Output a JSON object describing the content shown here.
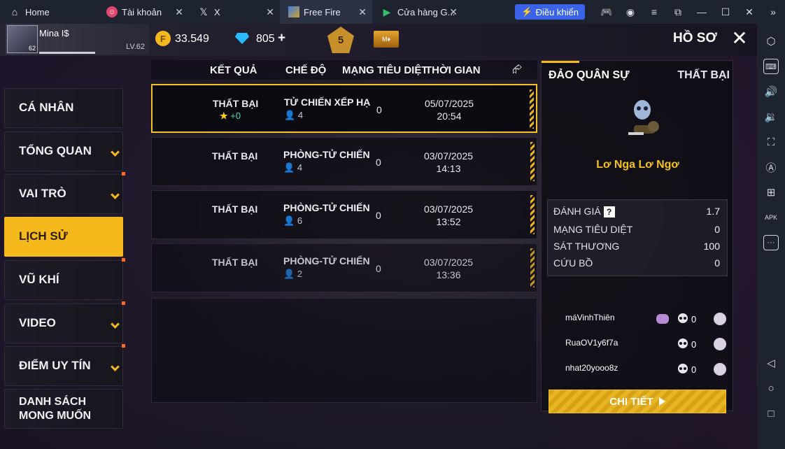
{
  "browser": {
    "tabs": [
      {
        "title": "Home",
        "icon": "home-icon",
        "closable": false
      },
      {
        "title": "Tài khoản",
        "icon": "account-app-icon",
        "closable": true
      },
      {
        "title": "X",
        "icon": "x-logo-icon",
        "closable": true
      },
      {
        "title": "Free Fire",
        "icon": "free-fire-app-icon",
        "closable": true
      },
      {
        "title": "Cửa hàng G...",
        "icon": "play-store-icon",
        "closable": true
      }
    ],
    "control_button": "Điều khiển"
  },
  "player": {
    "name": "Mina I$",
    "level_label": "LV.62",
    "avatar_level": "62"
  },
  "currency": {
    "gold": "33.549",
    "diamonds": "805"
  },
  "rank_badge": "5",
  "page_title": "HỒ SƠ",
  "menu": [
    {
      "label": "CÁ NHÂN",
      "chevron": false,
      "dot": false,
      "active": false
    },
    {
      "label": "TỔNG QUAN",
      "chevron": true,
      "dot": false,
      "active": false
    },
    {
      "label": "VAI TRÒ",
      "chevron": true,
      "dot": true,
      "active": false
    },
    {
      "label": "LỊCH SỬ",
      "chevron": false,
      "dot": false,
      "active": true
    },
    {
      "label": "VŨ KHÍ",
      "chevron": false,
      "dot": true,
      "active": false
    },
    {
      "label": "VIDEO",
      "chevron": true,
      "dot": true,
      "active": false
    },
    {
      "label": "ĐIỂM UY TÍN",
      "chevron": true,
      "dot": true,
      "active": false
    },
    {
      "label": "DANH SÁCH MONG MUỐN",
      "chevron": false,
      "dot": false,
      "active": false
    }
  ],
  "table": {
    "headers": {
      "result": "KẾT QUẢ",
      "mode": "CHẾ ĐỘ",
      "kills": "MẠNG TIÊU DIỆT",
      "time": "THỜI GIAN"
    },
    "rows": [
      {
        "result": "THẤT BẠI",
        "gain": "+0",
        "mode": "TỬ CHIẾN XẾP HẠ",
        "players": "4",
        "kills": "0",
        "date": "05/07/2025",
        "time": "20:54"
      },
      {
        "result": "THẤT BẠI",
        "gain": "",
        "mode": "PHÒNG-TỬ CHIẾN",
        "players": "4",
        "kills": "0",
        "date": "03/07/2025",
        "time": "14:13"
      },
      {
        "result": "THẤT BẠI",
        "gain": "",
        "mode": "PHÒNG-TỬ CHIẾN",
        "players": "6",
        "kills": "0",
        "date": "03/07/2025",
        "time": "13:52"
      },
      {
        "result": "THẤT BẠI",
        "gain": "",
        "mode": "PHÒNG-TỬ CHIẾN",
        "players": "2",
        "kills": "0",
        "date": "03/07/2025",
        "time": "13:36"
      }
    ]
  },
  "detail": {
    "map": "ĐẢO QUÂN SỰ",
    "result": "THẤT BẠI",
    "character": "Lơ Nga Lơ Ngơ",
    "stats": [
      {
        "label": "ĐÁNH GIÁ",
        "value": "1.7",
        "help": true
      },
      {
        "label": "MẠNG TIÊU DIỆT",
        "value": "0",
        "help": false
      },
      {
        "label": "SÁT THƯƠNG",
        "value": "100",
        "help": false
      },
      {
        "label": "CỨU BỒ",
        "value": "0",
        "help": false
      }
    ],
    "players": [
      {
        "name": "máVinhThiên",
        "kills": "0",
        "gift": true
      },
      {
        "name": "RuaOV1y6f7a",
        "kills": "0",
        "gift": false
      },
      {
        "name": "nhat20yooo8z",
        "kills": "0",
        "gift": false
      }
    ],
    "button": "CHI TIẾT"
  }
}
